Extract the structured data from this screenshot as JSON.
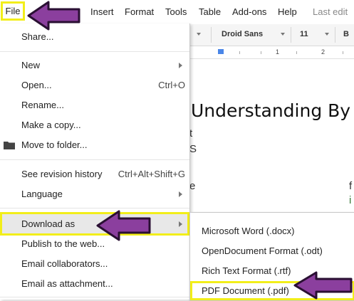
{
  "menubar": {
    "file": "File",
    "items": [
      "Insert",
      "Format",
      "Tools",
      "Table",
      "Add-ons",
      "Help"
    ],
    "last_edit": "Last edit"
  },
  "toolbar": {
    "font": "Droid Sans",
    "size": "11",
    "bold": "B"
  },
  "ruler": {
    "mark_1": "1",
    "mark_2": "2"
  },
  "document": {
    "heading": "Understanding By D",
    "fragments": [
      "t",
      "S",
      "e",
      "f",
      "i"
    ]
  },
  "file_menu": {
    "share": "Share...",
    "new": "New",
    "open": "Open...",
    "open_shortcut": "Ctrl+O",
    "rename": "Rename...",
    "make_copy": "Make a copy...",
    "move_to_folder": "Move to folder...",
    "revision_history": "See revision history",
    "revision_shortcut": "Ctrl+Alt+Shift+G",
    "language": "Language",
    "download_as": "Download as",
    "publish": "Publish to the web...",
    "email_collaborators": "Email collaborators...",
    "email_attachment": "Email as attachment..."
  },
  "download_submenu": {
    "docx": "Microsoft Word (.docx)",
    "odt": "OpenDocument Format (.odt)",
    "rtf": "Rich Text Format (.rtf)",
    "pdf": "PDF Document (.pdf)"
  },
  "colors": {
    "highlight": "#f2ee1a",
    "arrow_fill": "#8b3f9e",
    "arrow_stroke": "#2a0f33",
    "hover": "#e8e8e8"
  },
  "icons": {
    "folder": "folder-icon",
    "submenu": "chevron-right-icon",
    "callout": "arrow-left-icon"
  }
}
